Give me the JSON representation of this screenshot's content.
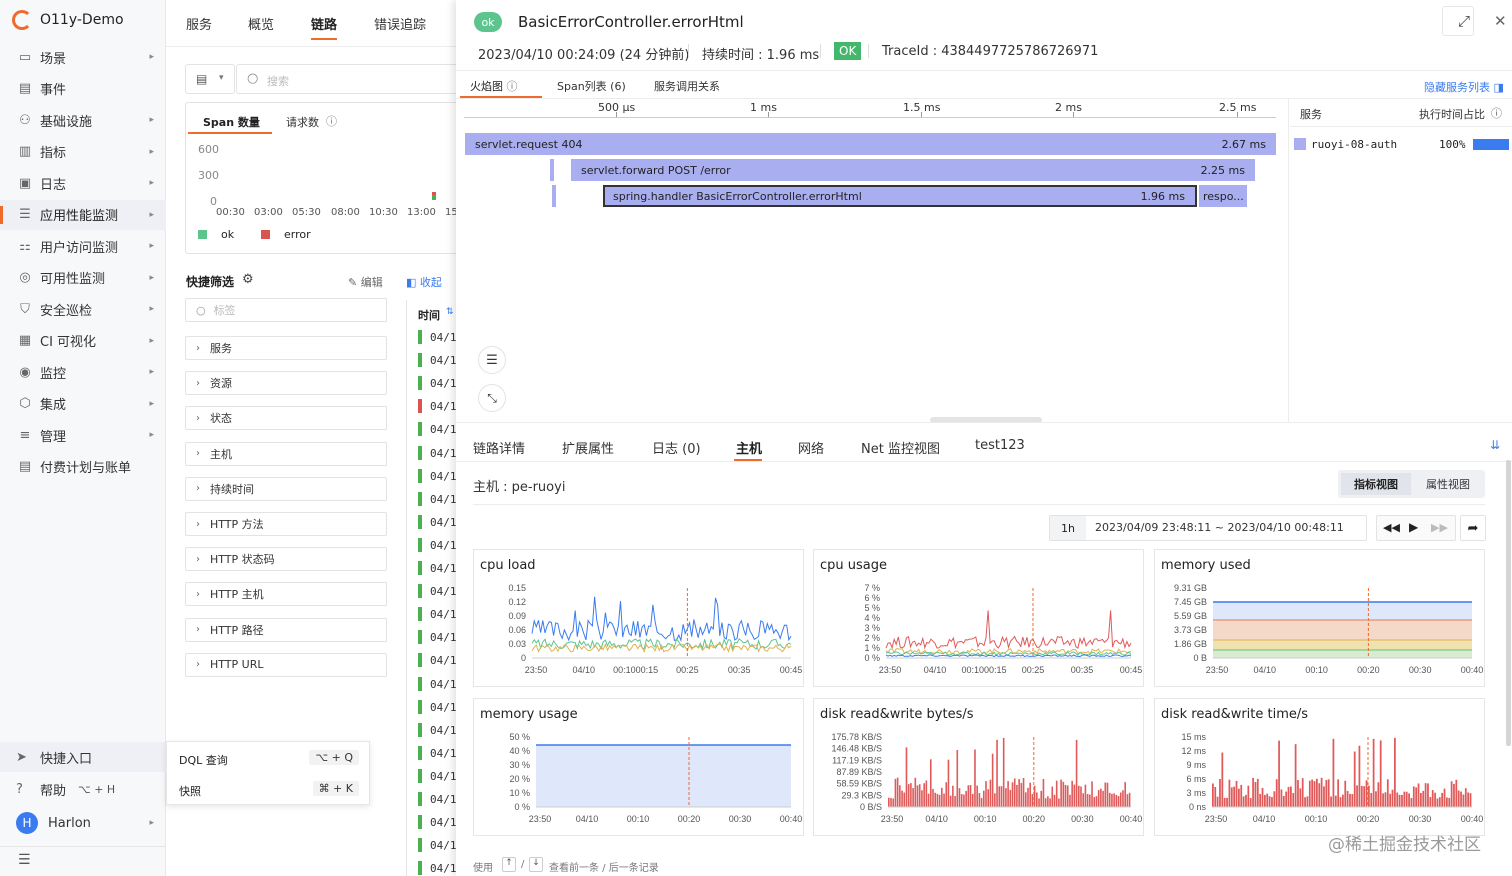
{
  "sidebar": {
    "title": "O11y-Demo",
    "items": [
      {
        "label": "场景",
        "icon": "scene-icon",
        "glyph": "▭",
        "arrow": true
      },
      {
        "label": "事件",
        "icon": "calendar-icon",
        "glyph": "▤",
        "arrow": false
      },
      {
        "label": "基础设施",
        "icon": "infra-icon",
        "glyph": "⚇",
        "arrow": true
      },
      {
        "label": "指标",
        "icon": "chart-icon",
        "glyph": "▥",
        "arrow": true
      },
      {
        "label": "日志",
        "icon": "log-icon",
        "glyph": "▣",
        "arrow": true
      },
      {
        "label": "应用性能监测",
        "icon": "apm-icon",
        "glyph": "☰",
        "arrow": true,
        "active": true
      },
      {
        "label": "用户访问监测",
        "icon": "rum-icon",
        "glyph": "⚏",
        "arrow": true
      },
      {
        "label": "可用性监测",
        "icon": "availability-icon",
        "glyph": "◎",
        "arrow": true
      },
      {
        "label": "安全巡检",
        "icon": "shield-icon",
        "glyph": "⛉",
        "arrow": true
      },
      {
        "label": "CI 可视化",
        "icon": "ci-icon",
        "glyph": "▦",
        "arrow": true
      },
      {
        "label": "监控",
        "icon": "monitor-icon",
        "glyph": "◉",
        "arrow": true
      },
      {
        "label": "集成",
        "icon": "integration-icon",
        "glyph": "⬡",
        "arrow": true
      },
      {
        "label": "管理",
        "icon": "manage-icon",
        "glyph": "≡",
        "arrow": true
      },
      {
        "label": "付费计划与账单",
        "icon": "billing-icon",
        "glyph": "▤",
        "arrow": false
      }
    ],
    "quick_entry": "快捷入口",
    "help": "帮助",
    "help_shortcut": "⌥ + H",
    "user": "Harlon",
    "avatar_letter": "H"
  },
  "topnav": [
    "服务",
    "概览",
    "链路",
    "错误追踪"
  ],
  "search_placeholder": "搜索",
  "stats_tabs": [
    "Span 数量",
    "请求数"
  ],
  "stats_y": [
    "600",
    "300",
    "0"
  ],
  "stats_x": [
    "00:30",
    "03:00",
    "05:30",
    "08:00",
    "10:30",
    "13:00",
    "15"
  ],
  "legend": [
    "ok",
    "error"
  ],
  "quick_filter": {
    "title": "快捷筛选",
    "edit": "编辑",
    "collapse": "收起",
    "search_placeholder": "标签",
    "items": [
      "服务",
      "资源",
      "状态",
      "主机",
      "持续时间",
      "HTTP 方法",
      "HTTP 状态码",
      "HTTP 主机",
      "HTTP 路径",
      "HTTP URL"
    ]
  },
  "list_header": "时间",
  "list_prefix": "04/1",
  "quick_menu": [
    {
      "label": "DQL 查询",
      "shortcut": "⌥ + Q"
    },
    {
      "label": "快照",
      "shortcut": "⌘ + K"
    }
  ],
  "drawer": {
    "status": "ok",
    "title": "BasicErrorController.errorHtml",
    "time": "2023/04/10 00:24:09 (24 分钟前)",
    "duration": "持续时间 : 1.96 ms",
    "ok_label": "OK",
    "trace_id": "TraceId : 4384497725786726971",
    "tabs": [
      "火焰图",
      "Span列表 (6)",
      "服务调用关系"
    ],
    "hide_service_list": "隐藏服务列表",
    "ruler": [
      "500 μs",
      "1 ms",
      "1.5 ms",
      "2 ms",
      "2.5 ms"
    ],
    "spans": [
      {
        "name": "servlet.request 404",
        "dur": "2.67 ms"
      },
      {
        "name": "servlet.forward POST /error",
        "dur": "2.25 ms"
      },
      {
        "name": "spring.handler BasicErrorController.errorHtml",
        "dur": "1.96 ms"
      },
      {
        "name": "respo...",
        "dur": ""
      }
    ],
    "service_header": "服务",
    "ratio_header": "执行时间占比",
    "service_row": {
      "name": "ruoyi-08-auth",
      "ratio": "100%"
    },
    "bottom_tabs": [
      "链路详情",
      "扩展属性",
      "日志 (0)",
      "主机",
      "网络",
      "Net 监控视图",
      "test123"
    ],
    "host_label": "主机 : pe-ruoyi",
    "view_buttons": [
      "指标视图",
      "属性视图"
    ],
    "range_label": "1h",
    "range": "2023/04/09 23:48:11 ~ 2023/04/10 00:48:11",
    "footer": {
      "use": "使用",
      "sep": "/",
      "text": "查看前一条 / 后一条记录"
    },
    "watermark": "@稀土掘金技术社区"
  },
  "chart_data": [
    {
      "type": "line",
      "title": "cpu load",
      "ylabels": [
        "0.15",
        "0.12",
        "0.09",
        "0.06",
        "0.03",
        "0"
      ],
      "xlabels": [
        "23:50",
        "04/10",
        "00:1000:15",
        "00:25",
        "00:35",
        "00:45"
      ],
      "ylim": [
        0,
        0.15
      ]
    },
    {
      "type": "line",
      "title": "cpu usage",
      "ylabels": [
        "7 %",
        "6 %",
        "5 %",
        "4 %",
        "3 %",
        "2 %",
        "1 %",
        "0 %"
      ],
      "xlabels": [
        "23:50",
        "04/10",
        "00:1000:15",
        "00:25",
        "00:35",
        "00:45"
      ],
      "ylim": [
        0,
        7
      ]
    },
    {
      "type": "area",
      "title": "memory used",
      "ylabels": [
        "9.31 GB",
        "7.45 GB",
        "5.59 GB",
        "3.73 GB",
        "1.86 GB",
        "0 B"
      ],
      "xlabels": [
        "23:50",
        "04/10",
        "00:10",
        "00:20",
        "00:30",
        "00:40"
      ],
      "ylim": [
        0,
        9.31
      ]
    },
    {
      "type": "area",
      "title": "memory usage",
      "ylabels": [
        "50 %",
        "40 %",
        "30 %",
        "20 %",
        "10 %",
        "0 %"
      ],
      "xlabels": [
        "23:50",
        "04/10",
        "00:10",
        "00:20",
        "00:30",
        "00:40"
      ],
      "ylim": [
        0,
        50
      ]
    },
    {
      "type": "bar",
      "title": "disk read&write bytes/s",
      "ylabels": [
        "175.78 KB/S",
        "146.48 KB/S",
        "117.19 KB/S",
        "87.89 KB/S",
        "58.59 KB/S",
        "29.3 KB/S",
        "0 B/S"
      ],
      "xlabels": [
        "23:50",
        "04/10",
        "00:10",
        "00:20",
        "00:30",
        "00:40"
      ],
      "ylim": [
        0,
        175.78
      ]
    },
    {
      "type": "bar",
      "title": "disk read&write time/s",
      "ylabels": [
        "15 ms",
        "12 ms",
        "9 ms",
        "6 ms",
        "3 ms",
        "0 ns"
      ],
      "xlabels": [
        "23:50",
        "04/10",
        "00:10",
        "00:20",
        "00:30",
        "00:40"
      ],
      "ylim": [
        0,
        15
      ]
    }
  ]
}
